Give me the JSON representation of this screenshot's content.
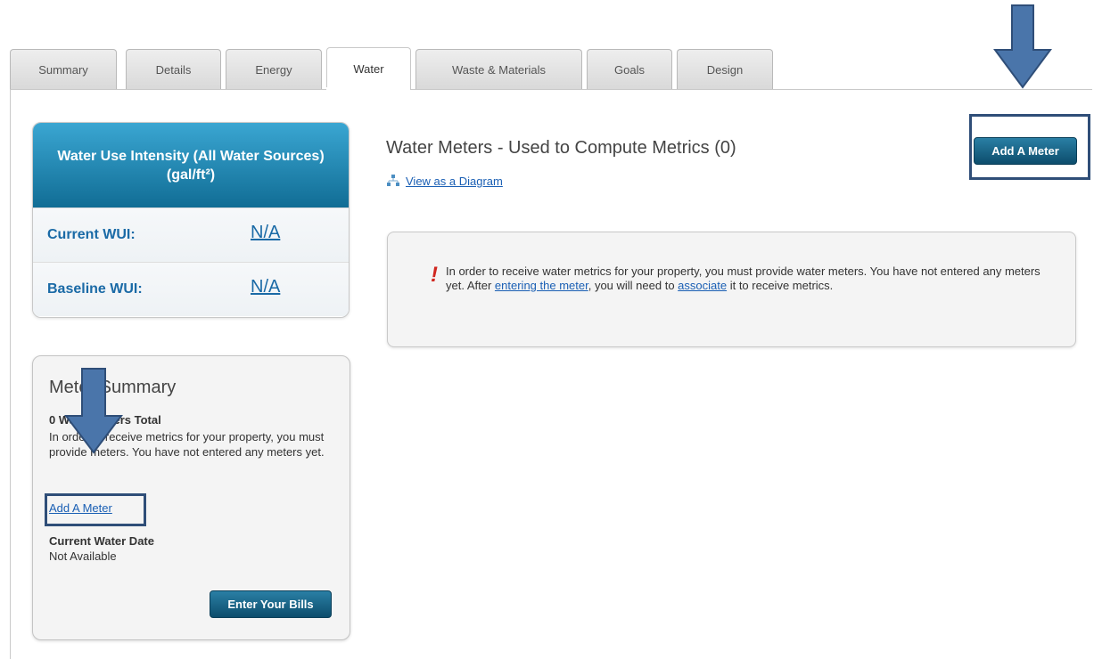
{
  "tabs": [
    {
      "label": "Summary",
      "active": false
    },
    {
      "label": "Details",
      "active": false
    },
    {
      "label": "Energy",
      "active": false
    },
    {
      "label": "Water",
      "active": true
    },
    {
      "label": "Waste & Materials",
      "active": false
    },
    {
      "label": "Goals",
      "active": false
    },
    {
      "label": "Design",
      "active": false
    }
  ],
  "wui": {
    "title": "Water Use Intensity (All Water Sources) (gal/ft²)",
    "current_label": "Current WUI:",
    "current_value": "N/A",
    "baseline_label": "Baseline WUI:",
    "baseline_value": "N/A"
  },
  "meter_summary": {
    "title": "Meter Summary",
    "count": "0 Water Meters Total",
    "description": "In order to receive metrics for your property, you must provide meters. You have not entered any meters yet.",
    "add_link": "Add A Meter",
    "date_label": "Current Water Date",
    "date_value": "Not Available",
    "enter_bills_button": "Enter Your Bills"
  },
  "main": {
    "title": "Water Meters - Used to Compute Metrics (0)",
    "add_button": "Add A Meter",
    "diagram_link": "View as a Diagram",
    "alert": {
      "part1": "In order to receive water metrics for your property, you must provide water meters. You have not entered any meters yet. After ",
      "link1": "entering the meter",
      "part2": ", you will need to ",
      "link2": "associate",
      "part3": " it to receive metrics."
    }
  },
  "colors": {
    "accent_dark": "#0d4d6c",
    "header_gradient_top": "#3aa6d2",
    "link": "#1a5fb4",
    "alert_red": "#d0261f",
    "annotation": "#2f4e78"
  },
  "icons": {
    "diagram": "diagram-icon",
    "alert": "exclamation-icon",
    "annotation_arrow": "arrow-down-icon"
  }
}
